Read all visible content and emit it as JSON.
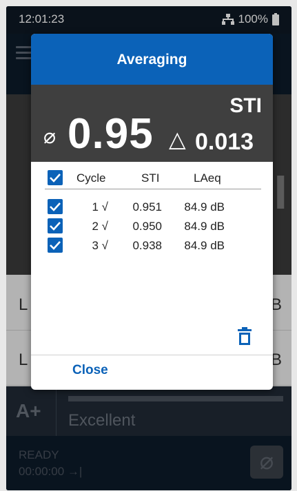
{
  "status_bar": {
    "time": "12:01:23",
    "battery": "100%"
  },
  "background": {
    "list": [
      {
        "label": "L",
        "value": "B"
      },
      {
        "label": "L",
        "value": "B"
      }
    ],
    "rating": {
      "grade": "A+",
      "label": "Excellent"
    },
    "footer": {
      "state": "READY",
      "timer": "00:00:00 →|"
    },
    "big_value_fragment": "I",
    "average_button_symbol": "⌀"
  },
  "dialog": {
    "title": "Averaging",
    "metric": "STI",
    "average_symbol": "⌀",
    "average_value": "0.95",
    "delta_symbol": "△",
    "delta_value": "0.013",
    "columns": [
      "Cycle",
      "STI",
      "LAeq"
    ],
    "rows": [
      {
        "cycle": "1 √",
        "sti": "0.951",
        "laeq": "84.9 dB",
        "checked": true
      },
      {
        "cycle": "2 √",
        "sti": "0.950",
        "laeq": "84.9 dB",
        "checked": true
      },
      {
        "cycle": "3 √",
        "sti": "0.938",
        "laeq": "84.9 dB",
        "checked": true
      }
    ],
    "select_all_checked": true,
    "close_label": "Close"
  },
  "colors": {
    "accent": "#0b62b8",
    "result_bg": "#3f3f3f",
    "screen_bg": "#13202e"
  },
  "icons": [
    "network-icon",
    "battery-icon",
    "menu-icon",
    "checkbox-icon",
    "trash-icon"
  ]
}
